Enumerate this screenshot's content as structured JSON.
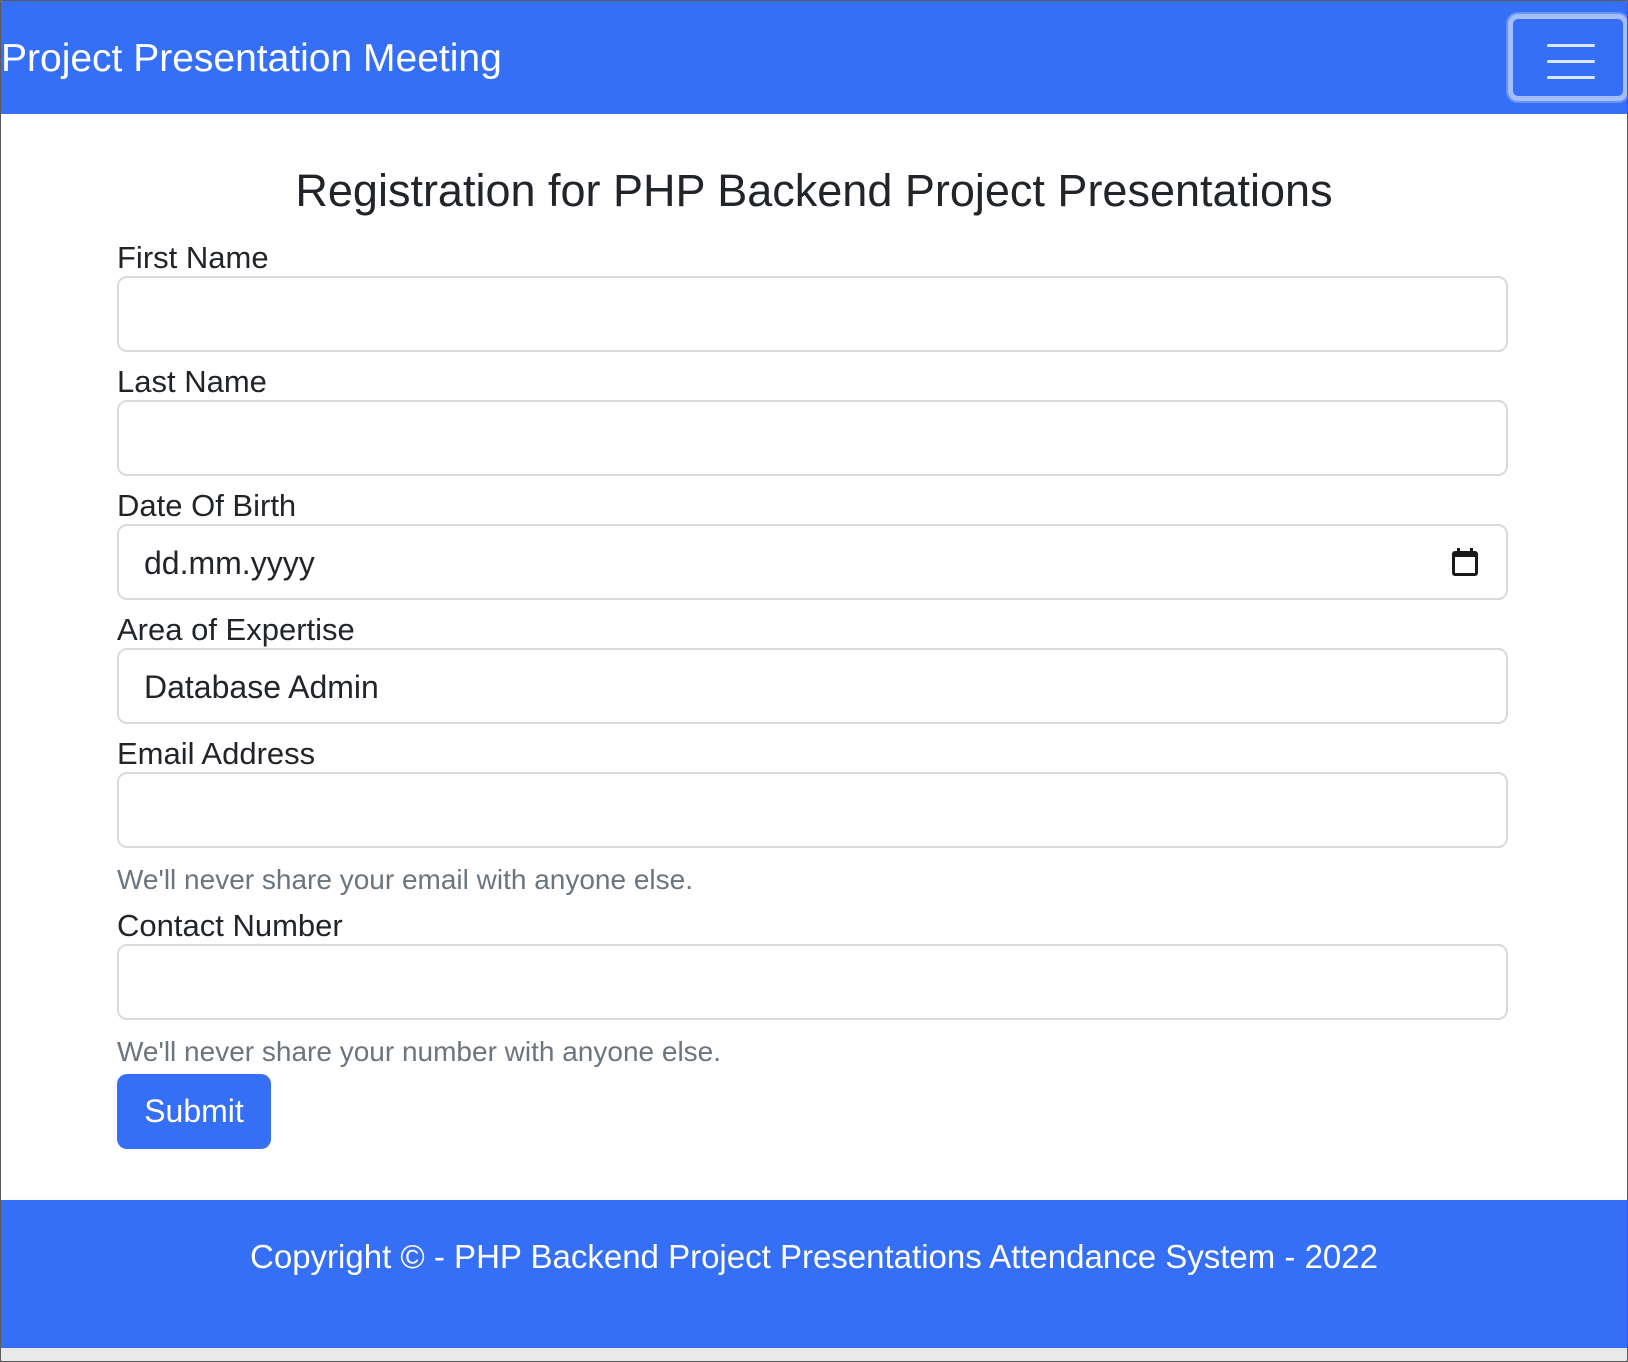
{
  "navbar": {
    "brand": "Project Presentation Meeting",
    "toggler_icon": "hamburger-menu-icon"
  },
  "main": {
    "title": "Registration for PHP Backend Project Presentations",
    "fields": {
      "first_name": {
        "label": "First Name",
        "value": ""
      },
      "last_name": {
        "label": "Last Name",
        "value": ""
      },
      "dob": {
        "label": "Date Of Birth",
        "placeholder": "dd.mm.yyyy",
        "icon": "calendar-icon"
      },
      "expertise": {
        "label": "Area of Expertise",
        "value": "Database Admin"
      },
      "email": {
        "label": "Email Address",
        "value": "",
        "help": "We'll never share your email with anyone else."
      },
      "contact": {
        "label": "Contact Number",
        "value": "",
        "help": "We'll never share your number with anyone else."
      }
    },
    "submit_label": "Submit"
  },
  "footer": {
    "text": "Copyright © - PHP Backend Project Presentations Attendance System - 2022"
  },
  "colors": {
    "primary": "#356ff6",
    "text": "#212529",
    "muted": "#6c757d",
    "border": "#d8dbde"
  }
}
